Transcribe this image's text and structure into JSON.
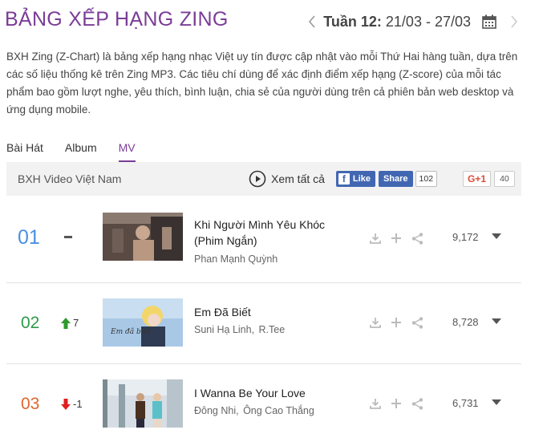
{
  "header": {
    "title": "BẢNG XẾP HẠNG ZING",
    "week_prefix": "Tuần 12:",
    "week_range": "21/03 - 27/03"
  },
  "description": "BXH Zing (Z-Chart) là bảng xếp hạng nhạc Việt uy tín được cập nhật vào mỗi Thứ Hai hàng tuần, dựa trên các số liệu thống kê trên Zing MP3. Các tiêu chí dùng để xác định điểm xếp hạng (Z-score) của mỗi tác phẩm bao gồm lượt nghe, yêu thích, bình luận, chia sẻ của người dùng trên cả phiên bản web desktop và ứng dụng mobile.",
  "tabs": [
    {
      "label": "Bài Hát",
      "active": false
    },
    {
      "label": "Album",
      "active": false
    },
    {
      "label": "MV",
      "active": true
    }
  ],
  "chart_bar": {
    "title": "BXH Video Việt Nam",
    "see_all": "Xem tất cả",
    "fb_like": "Like",
    "fb_share": "Share",
    "fb_count": "102",
    "gplus": "G+1",
    "gplus_count": "40"
  },
  "items": [
    {
      "rank": "01",
      "change": "",
      "title": "Khi Người Mình Yêu Khóc (Phim Ngắn)",
      "artists": [
        "Phan Mạnh Quỳnh"
      ],
      "views": "9,172"
    },
    {
      "rank": "02",
      "change": "7",
      "title": "Em Đã Biết",
      "artists": [
        "Suni Hạ Linh",
        "R.Tee"
      ],
      "views": "8,728"
    },
    {
      "rank": "03",
      "change": "-1",
      "title": "I Wanna Be Your Love",
      "artists": [
        "Đông Nhi",
        "Ông Cao Thắng"
      ],
      "views": "6,731"
    }
  ],
  "colors": {
    "brand": "#7b3d97",
    "rank1": "#4a90e2",
    "rank2": "#2e9a4a",
    "rank3": "#e0662c",
    "up": "#2e9a2e",
    "down": "#e02020"
  }
}
